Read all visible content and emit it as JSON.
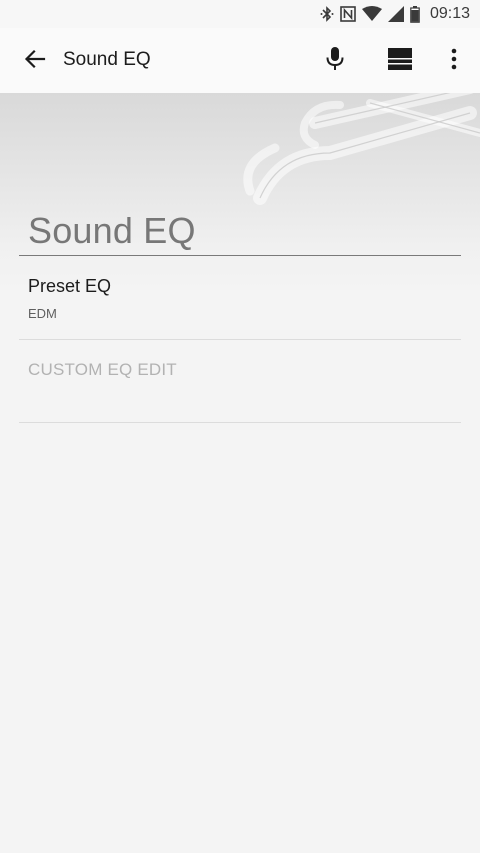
{
  "status_bar": {
    "time": "09:13",
    "icons": [
      "bluetooth-icon",
      "nfc-icon",
      "wifi-icon",
      "cellular-signal-icon",
      "battery-icon"
    ]
  },
  "app_bar": {
    "title": "Sound EQ",
    "actions": [
      "back-arrow-icon",
      "microphone-icon",
      "theme-icon",
      "more-options-icon"
    ]
  },
  "header": {
    "title": "Sound EQ"
  },
  "preferences": {
    "preset": {
      "title": "Preset EQ",
      "summary": "EDM"
    },
    "custom": {
      "label": "CUSTOM EQ EDIT",
      "enabled": false
    }
  },
  "colors": {
    "background": "#f4f4f4",
    "app_bar": "#fafafa",
    "header_title": "#777777",
    "disabled_text": "#b2b2b2",
    "divider": "#dcdcdc"
  }
}
